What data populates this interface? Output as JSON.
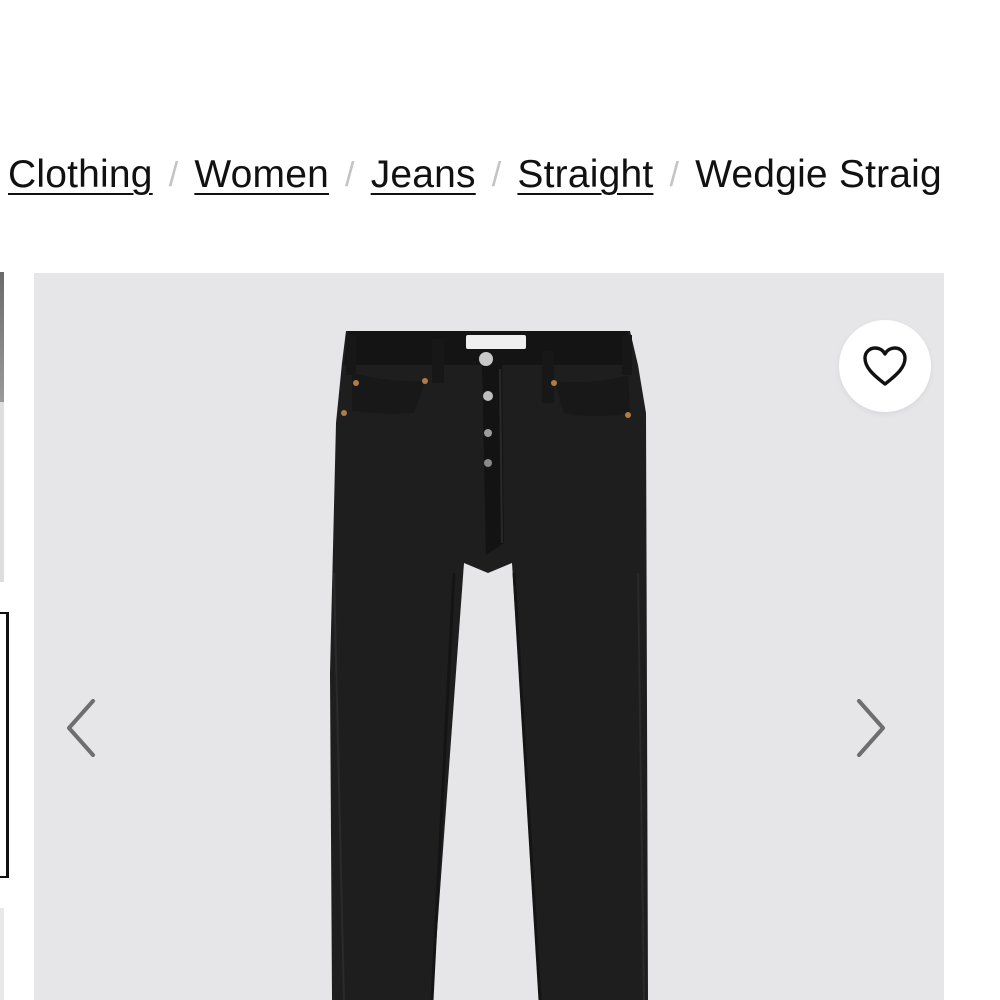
{
  "breadcrumb": {
    "items": [
      {
        "label": "Clothing"
      },
      {
        "label": "Women"
      },
      {
        "label": "Jeans"
      },
      {
        "label": "Straight"
      }
    ],
    "separator": "/",
    "current": "Wedgie Straig"
  },
  "gallery": {
    "background_color": "#e6e5e8",
    "product_color": "#1e1e1e",
    "wishlist_icon": "heart-icon",
    "prev_icon": "chevron-left-icon",
    "next_icon": "chevron-right-icon"
  }
}
